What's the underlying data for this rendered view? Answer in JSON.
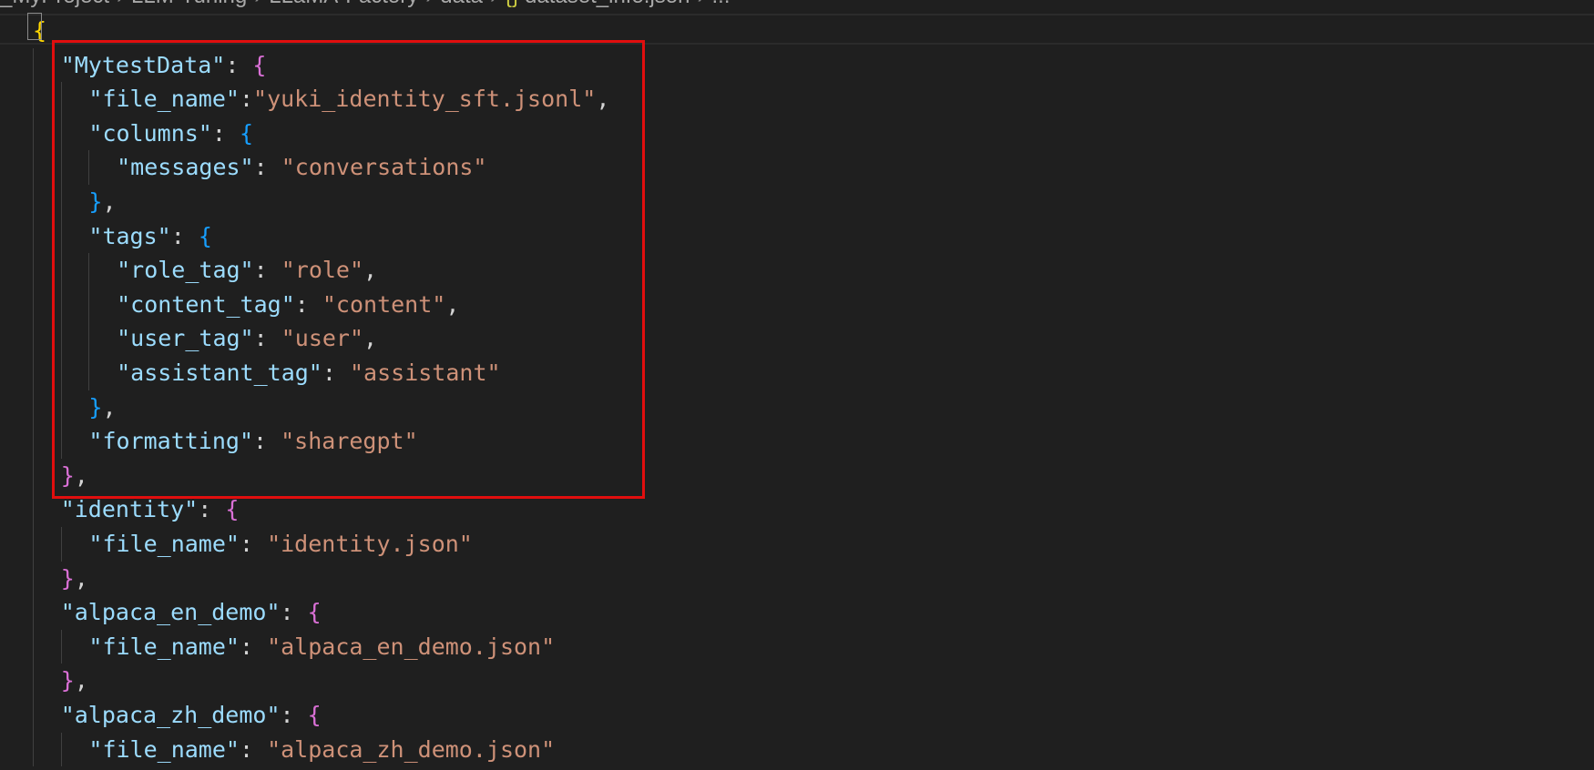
{
  "breadcrumb": {
    "items": [
      "_MyProject",
      "LLM-Tuning",
      "LLaMA-Factory",
      "data"
    ],
    "file": "dataset_info.json",
    "file_icon": "{}",
    "trailing": "..."
  },
  "colors": {
    "background": "#1f1f1f",
    "key": "#9cdcfe",
    "string": "#ce9178",
    "punctuation": "#d4d4d4",
    "bracket_level_1": "#ffd700",
    "bracket_level_2": "#da70d6",
    "bracket_level_3": "#179fff",
    "annotation_box": "#e10e0e"
  },
  "code": {
    "lines": [
      [
        {
          "t": "{",
          "c": "b-gold"
        }
      ],
      [
        {
          "t": "\"MytestData\"",
          "c": "key"
        },
        {
          "t": ": ",
          "c": "punc"
        },
        {
          "t": "{",
          "c": "b-pink"
        }
      ],
      [
        {
          "t": "\"file_name\"",
          "c": "key"
        },
        {
          "t": ":",
          "c": "punc"
        },
        {
          "t": "\"yuki_identity_sft.jsonl\"",
          "c": "str"
        },
        {
          "t": ",",
          "c": "punc"
        }
      ],
      [
        {
          "t": "\"columns\"",
          "c": "key"
        },
        {
          "t": ": ",
          "c": "punc"
        },
        {
          "t": "{",
          "c": "b-blue"
        }
      ],
      [
        {
          "t": "\"messages\"",
          "c": "key"
        },
        {
          "t": ": ",
          "c": "punc"
        },
        {
          "t": "\"conversations\"",
          "c": "str"
        }
      ],
      [
        {
          "t": "}",
          "c": "b-blue"
        },
        {
          "t": ",",
          "c": "punc"
        }
      ],
      [
        {
          "t": "\"tags\"",
          "c": "key"
        },
        {
          "t": ": ",
          "c": "punc"
        },
        {
          "t": "{",
          "c": "b-blue"
        }
      ],
      [
        {
          "t": "\"role_tag\"",
          "c": "key"
        },
        {
          "t": ": ",
          "c": "punc"
        },
        {
          "t": "\"role\"",
          "c": "str"
        },
        {
          "t": ",",
          "c": "punc"
        }
      ],
      [
        {
          "t": "\"content_tag\"",
          "c": "key"
        },
        {
          "t": ": ",
          "c": "punc"
        },
        {
          "t": "\"content\"",
          "c": "str"
        },
        {
          "t": ",",
          "c": "punc"
        }
      ],
      [
        {
          "t": "\"user_tag\"",
          "c": "key"
        },
        {
          "t": ": ",
          "c": "punc"
        },
        {
          "t": "\"user\"",
          "c": "str"
        },
        {
          "t": ",",
          "c": "punc"
        }
      ],
      [
        {
          "t": "\"assistant_tag\"",
          "c": "key"
        },
        {
          "t": ": ",
          "c": "punc"
        },
        {
          "t": "\"assistant\"",
          "c": "str"
        }
      ],
      [
        {
          "t": "}",
          "c": "b-blue"
        },
        {
          "t": ",",
          "c": "punc"
        }
      ],
      [
        {
          "t": "\"formatting\"",
          "c": "key"
        },
        {
          "t": ": ",
          "c": "punc"
        },
        {
          "t": "\"sharegpt\"",
          "c": "str"
        }
      ],
      [
        {
          "t": "}",
          "c": "b-pink"
        },
        {
          "t": ",",
          "c": "punc"
        }
      ],
      [
        {
          "t": "\"identity\"",
          "c": "key"
        },
        {
          "t": ": ",
          "c": "punc"
        },
        {
          "t": "{",
          "c": "b-pink"
        }
      ],
      [
        {
          "t": "\"file_name\"",
          "c": "key"
        },
        {
          "t": ": ",
          "c": "punc"
        },
        {
          "t": "\"identity.json\"",
          "c": "str"
        }
      ],
      [
        {
          "t": "}",
          "c": "b-pink"
        },
        {
          "t": ",",
          "c": "punc"
        }
      ],
      [
        {
          "t": "\"alpaca_en_demo\"",
          "c": "key"
        },
        {
          "t": ": ",
          "c": "punc"
        },
        {
          "t": "{",
          "c": "b-pink"
        }
      ],
      [
        {
          "t": "\"file_name\"",
          "c": "key"
        },
        {
          "t": ": ",
          "c": "punc"
        },
        {
          "t": "\"alpaca_en_demo.json\"",
          "c": "str"
        }
      ],
      [
        {
          "t": "}",
          "c": "b-pink"
        },
        {
          "t": ",",
          "c": "punc"
        }
      ],
      [
        {
          "t": "\"alpaca_zh_demo\"",
          "c": "key"
        },
        {
          "t": ": ",
          "c": "punc"
        },
        {
          "t": "{",
          "c": "b-pink"
        }
      ],
      [
        {
          "t": "\"file_name\"",
          "c": "key"
        },
        {
          "t": ": ",
          "c": "punc"
        },
        {
          "t": "\"alpaca_zh_demo.json\"",
          "c": "str"
        }
      ]
    ]
  }
}
